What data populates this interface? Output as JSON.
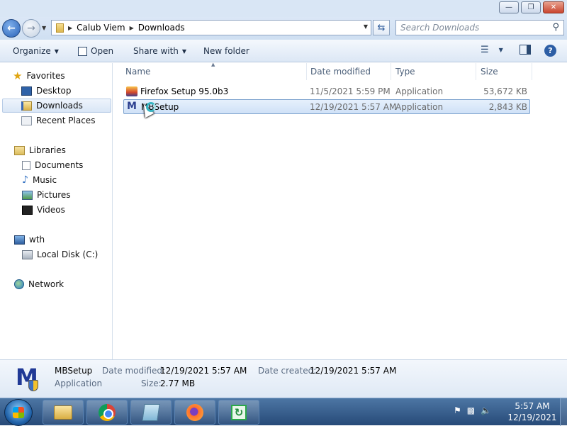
{
  "window": {
    "minimize_icon": "minimize-icon",
    "maximize_icon": "restore-icon",
    "close_icon": "close-icon"
  },
  "address": {
    "back_icon": "back-arrow-icon",
    "forward_icon": "forward-arrow-icon",
    "crumbs": [
      "Calub Viem",
      "Downloads"
    ],
    "refresh_icon": "refresh-icon",
    "search_placeholder": "Search Downloads",
    "search_icon": "search-icon"
  },
  "toolbar": {
    "organize": "Organize",
    "open": "Open",
    "share_with": "Share with",
    "new_folder": "New folder",
    "views_icon": "views-icon",
    "preview_pane_icon": "preview-pane-icon",
    "help_icon": "help-icon"
  },
  "sidebar": {
    "favorites": "Favorites",
    "desktop": "Desktop",
    "downloads": "Downloads",
    "recent_places": "Recent Places",
    "libraries": "Libraries",
    "documents": "Documents",
    "music": "Music",
    "pictures": "Pictures",
    "videos": "Videos",
    "computer": "wth",
    "local_disk": "Local Disk (C:)",
    "network": "Network"
  },
  "filelist": {
    "columns": {
      "name": "Name",
      "date_modified": "Date modified",
      "type": "Type",
      "size": "Size"
    },
    "rows": [
      {
        "name": "Firefox Setup 95.0b3",
        "date_modified": "11/5/2021 5:59 PM",
        "type": "Application",
        "size": "53,672 KB",
        "icon": "firefox-installer-icon",
        "selected": false
      },
      {
        "name": "MBSetup",
        "date_modified": "12/19/2021 5:57 AM",
        "type": "Application",
        "size": "2,843 KB",
        "icon": "malwarebytes-icon",
        "selected": true
      }
    ]
  },
  "details": {
    "name": "MBSetup",
    "type": "Application",
    "date_modified_label": "Date modified:",
    "date_modified": "12/19/2021 5:57 AM",
    "date_created_label": "Date created:",
    "date_created": "12/19/2021 5:57 AM",
    "size_label": "Size:",
    "size": "2.77 MB"
  },
  "taskbar": {
    "apps": [
      "explorer-icon",
      "chrome-icon",
      "notepad-icon",
      "firefox-icon",
      "sync-app-icon"
    ],
    "time": "5:57 AM",
    "date": "12/19/2021"
  },
  "colors": {
    "selection": "#cfe1f7",
    "taskbar": "#274a78",
    "accent": "#2d5ea5"
  }
}
